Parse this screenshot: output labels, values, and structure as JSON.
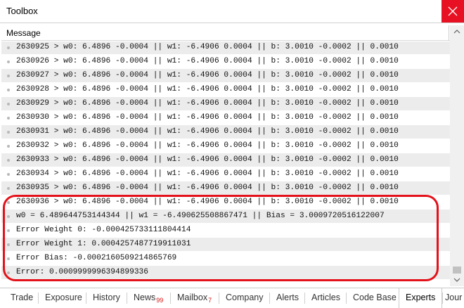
{
  "window": {
    "title": "Toolbox"
  },
  "list": {
    "column_header": "Message",
    "rows": [
      "2630925 > w0: 6.4896 -0.0004 || w1: -6.4906 0.0004 || b: 3.0010 -0.0002 || 0.0010",
      "2630926 > w0: 6.4896 -0.0004 || w1: -6.4906 0.0004 || b: 3.0010 -0.0002 || 0.0010",
      "2630927 > w0: 6.4896 -0.0004 || w1: -6.4906 0.0004 || b: 3.0010 -0.0002 || 0.0010",
      "2630928 > w0: 6.4896 -0.0004 || w1: -6.4906 0.0004 || b: 3.0010 -0.0002 || 0.0010",
      "2630929 > w0: 6.4896 -0.0004 || w1: -6.4906 0.0004 || b: 3.0010 -0.0002 || 0.0010",
      "2630930 > w0: 6.4896 -0.0004 || w1: -6.4906 0.0004 || b: 3.0010 -0.0002 || 0.0010",
      "2630931 > w0: 6.4896 -0.0004 || w1: -6.4906 0.0004 || b: 3.0010 -0.0002 || 0.0010",
      "2630932 > w0: 6.4896 -0.0004 || w1: -6.4906 0.0004 || b: 3.0010 -0.0002 || 0.0010",
      "2630933 > w0: 6.4896 -0.0004 || w1: -6.4906 0.0004 || b: 3.0010 -0.0002 || 0.0010",
      "2630934 > w0: 6.4896 -0.0004 || w1: -6.4906 0.0004 || b: 3.0010 -0.0002 || 0.0010",
      "2630935 > w0: 6.4896 -0.0004 || w1: -6.4906 0.0004 || b: 3.0010 -0.0002 || 0.0010",
      "2630936 > w0: 6.4896 -0.0004 || w1: -6.4906 0.0004 || b: 3.0010 -0.0002 || 0.0010",
      "w0 = 6.489644753144344 || w1 = -6.490625508867471 || Bias = 3.0009720516122007",
      "Error Weight 0: -0.000425733111804414",
      "Error Weight 1: 0.0004257487719911031",
      "Error Bias: -0.0002160509214865769",
      "Error: 0.0009999996394899336"
    ]
  },
  "tabs": [
    {
      "label": "Trade"
    },
    {
      "label": "Exposure"
    },
    {
      "label": "History"
    },
    {
      "label": "News",
      "badge": "99"
    },
    {
      "label": "Mailbox",
      "badge": "7"
    },
    {
      "label": "Company"
    },
    {
      "label": "Alerts"
    },
    {
      "label": "Articles"
    },
    {
      "label": "Code Base"
    },
    {
      "label": "Experts",
      "active": true
    },
    {
      "label": "Jour"
    }
  ],
  "colors": {
    "close_button": "#e81123",
    "highlight": "#e4111a",
    "stripe": "#ececec"
  },
  "icons": {
    "close": "close-icon",
    "scroll_up": "arrow-up-icon",
    "scroll_down": "arrow-down-icon"
  }
}
